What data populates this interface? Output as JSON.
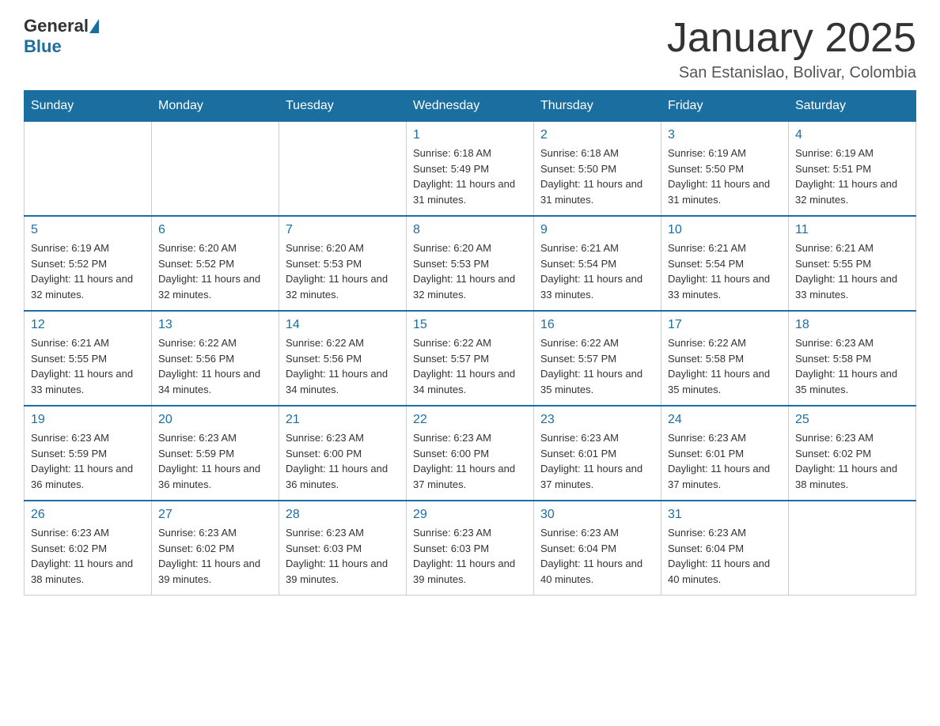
{
  "header": {
    "logo_general": "General",
    "logo_blue": "Blue",
    "month_title": "January 2025",
    "location": "San Estanislao, Bolivar, Colombia"
  },
  "days_of_week": [
    "Sunday",
    "Monday",
    "Tuesday",
    "Wednesday",
    "Thursday",
    "Friday",
    "Saturday"
  ],
  "weeks": [
    [
      {
        "day": "",
        "info": ""
      },
      {
        "day": "",
        "info": ""
      },
      {
        "day": "",
        "info": ""
      },
      {
        "day": "1",
        "info": "Sunrise: 6:18 AM\nSunset: 5:49 PM\nDaylight: 11 hours and 31 minutes."
      },
      {
        "day": "2",
        "info": "Sunrise: 6:18 AM\nSunset: 5:50 PM\nDaylight: 11 hours and 31 minutes."
      },
      {
        "day": "3",
        "info": "Sunrise: 6:19 AM\nSunset: 5:50 PM\nDaylight: 11 hours and 31 minutes."
      },
      {
        "day": "4",
        "info": "Sunrise: 6:19 AM\nSunset: 5:51 PM\nDaylight: 11 hours and 32 minutes."
      }
    ],
    [
      {
        "day": "5",
        "info": "Sunrise: 6:19 AM\nSunset: 5:52 PM\nDaylight: 11 hours and 32 minutes."
      },
      {
        "day": "6",
        "info": "Sunrise: 6:20 AM\nSunset: 5:52 PM\nDaylight: 11 hours and 32 minutes."
      },
      {
        "day": "7",
        "info": "Sunrise: 6:20 AM\nSunset: 5:53 PM\nDaylight: 11 hours and 32 minutes."
      },
      {
        "day": "8",
        "info": "Sunrise: 6:20 AM\nSunset: 5:53 PM\nDaylight: 11 hours and 32 minutes."
      },
      {
        "day": "9",
        "info": "Sunrise: 6:21 AM\nSunset: 5:54 PM\nDaylight: 11 hours and 33 minutes."
      },
      {
        "day": "10",
        "info": "Sunrise: 6:21 AM\nSunset: 5:54 PM\nDaylight: 11 hours and 33 minutes."
      },
      {
        "day": "11",
        "info": "Sunrise: 6:21 AM\nSunset: 5:55 PM\nDaylight: 11 hours and 33 minutes."
      }
    ],
    [
      {
        "day": "12",
        "info": "Sunrise: 6:21 AM\nSunset: 5:55 PM\nDaylight: 11 hours and 33 minutes."
      },
      {
        "day": "13",
        "info": "Sunrise: 6:22 AM\nSunset: 5:56 PM\nDaylight: 11 hours and 34 minutes."
      },
      {
        "day": "14",
        "info": "Sunrise: 6:22 AM\nSunset: 5:56 PM\nDaylight: 11 hours and 34 minutes."
      },
      {
        "day": "15",
        "info": "Sunrise: 6:22 AM\nSunset: 5:57 PM\nDaylight: 11 hours and 34 minutes."
      },
      {
        "day": "16",
        "info": "Sunrise: 6:22 AM\nSunset: 5:57 PM\nDaylight: 11 hours and 35 minutes."
      },
      {
        "day": "17",
        "info": "Sunrise: 6:22 AM\nSunset: 5:58 PM\nDaylight: 11 hours and 35 minutes."
      },
      {
        "day": "18",
        "info": "Sunrise: 6:23 AM\nSunset: 5:58 PM\nDaylight: 11 hours and 35 minutes."
      }
    ],
    [
      {
        "day": "19",
        "info": "Sunrise: 6:23 AM\nSunset: 5:59 PM\nDaylight: 11 hours and 36 minutes."
      },
      {
        "day": "20",
        "info": "Sunrise: 6:23 AM\nSunset: 5:59 PM\nDaylight: 11 hours and 36 minutes."
      },
      {
        "day": "21",
        "info": "Sunrise: 6:23 AM\nSunset: 6:00 PM\nDaylight: 11 hours and 36 minutes."
      },
      {
        "day": "22",
        "info": "Sunrise: 6:23 AM\nSunset: 6:00 PM\nDaylight: 11 hours and 37 minutes."
      },
      {
        "day": "23",
        "info": "Sunrise: 6:23 AM\nSunset: 6:01 PM\nDaylight: 11 hours and 37 minutes."
      },
      {
        "day": "24",
        "info": "Sunrise: 6:23 AM\nSunset: 6:01 PM\nDaylight: 11 hours and 37 minutes."
      },
      {
        "day": "25",
        "info": "Sunrise: 6:23 AM\nSunset: 6:02 PM\nDaylight: 11 hours and 38 minutes."
      }
    ],
    [
      {
        "day": "26",
        "info": "Sunrise: 6:23 AM\nSunset: 6:02 PM\nDaylight: 11 hours and 38 minutes."
      },
      {
        "day": "27",
        "info": "Sunrise: 6:23 AM\nSunset: 6:02 PM\nDaylight: 11 hours and 39 minutes."
      },
      {
        "day": "28",
        "info": "Sunrise: 6:23 AM\nSunset: 6:03 PM\nDaylight: 11 hours and 39 minutes."
      },
      {
        "day": "29",
        "info": "Sunrise: 6:23 AM\nSunset: 6:03 PM\nDaylight: 11 hours and 39 minutes."
      },
      {
        "day": "30",
        "info": "Sunrise: 6:23 AM\nSunset: 6:04 PM\nDaylight: 11 hours and 40 minutes."
      },
      {
        "day": "31",
        "info": "Sunrise: 6:23 AM\nSunset: 6:04 PM\nDaylight: 11 hours and 40 minutes."
      },
      {
        "day": "",
        "info": ""
      }
    ]
  ]
}
